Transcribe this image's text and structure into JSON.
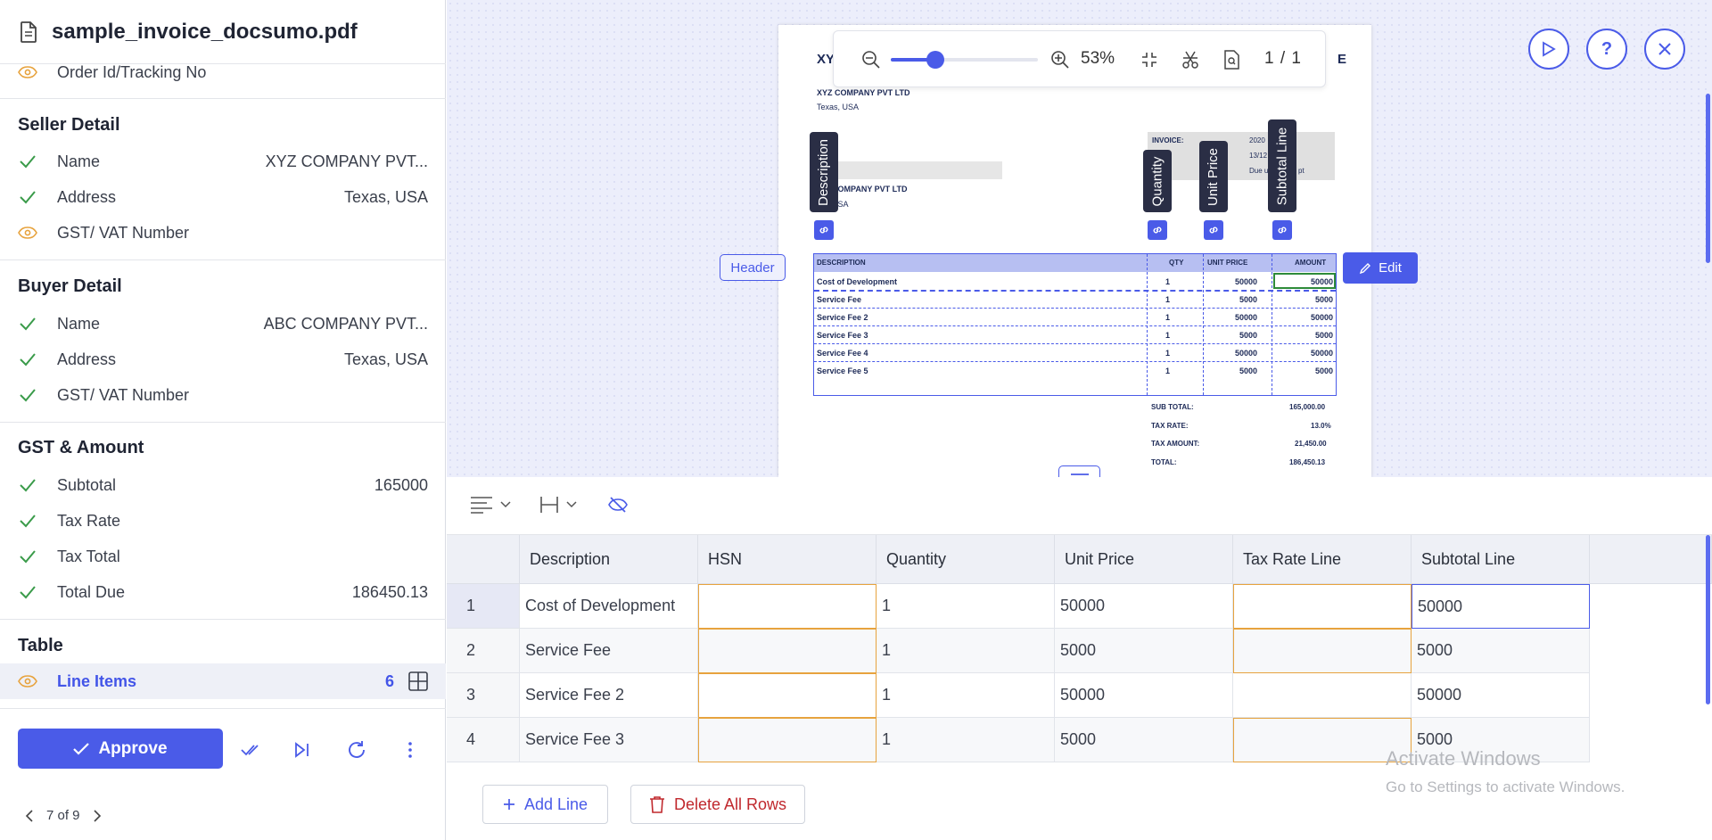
{
  "file": {
    "name": "sample_invoice_docsumo.pdf"
  },
  "fields": {
    "order_id": {
      "label": "Order Id/Tracking No"
    },
    "seller": {
      "title": "Seller Detail",
      "rows": [
        {
          "label": "Name",
          "value": "XYZ COMPANY PVT...",
          "status": "check"
        },
        {
          "label": "Address",
          "value": "Texas, USA",
          "status": "check"
        },
        {
          "label": "GST/ VAT Number",
          "value": "",
          "status": "eye"
        }
      ]
    },
    "buyer": {
      "title": "Buyer Detail",
      "rows": [
        {
          "label": "Name",
          "value": "ABC COMPANY PVT...",
          "status": "check"
        },
        {
          "label": "Address",
          "value": "Texas, USA",
          "status": "check"
        },
        {
          "label": "GST/ VAT Number",
          "value": "",
          "status": "check"
        }
      ]
    },
    "gst": {
      "title": "GST & Amount",
      "rows": [
        {
          "label": "Subtotal",
          "value": "165000",
          "status": "check"
        },
        {
          "label": "Tax Rate",
          "value": "",
          "status": "check"
        },
        {
          "label": "Tax Total",
          "value": "",
          "status": "check"
        },
        {
          "label": "Total Due",
          "value": "186450.13",
          "status": "check"
        }
      ]
    },
    "table": {
      "title": "Table",
      "line_items_label": "Line Items",
      "line_items_count": "6"
    }
  },
  "actions": {
    "approve": "Approve"
  },
  "pager": {
    "text": "7 of 9"
  },
  "viewer": {
    "zoom_text": "53%",
    "zoom_level": 0.3,
    "page_indicator": "1 / 1",
    "header_tag": "Header",
    "edit_label": "Edit",
    "column_tags": {
      "description": "Description",
      "quantity": "Quantity",
      "unit_price": "Unit Price",
      "subtotal": "Subtotal Line"
    }
  },
  "invoice": {
    "title_left": "XY",
    "title_right": "E",
    "seller_name": "XYZ COMPANY PVT LTD",
    "seller_addr": "Texas, USA",
    "bill_to_fragment": "D",
    "buyer_name_fragment": "COMPANY PVT LTD",
    "buyer_addr_fragment": "USA",
    "meta_labels": [
      "INVOICE:",
      "",
      "S:"
    ],
    "meta_values": [
      "2020",
      "13/12",
      "Due u"
    ],
    "meta_value_tail": "pt",
    "headers": [
      "DESCRIPTION",
      "QTY",
      "UNIT PRICE",
      "AMOUNT"
    ],
    "rows": [
      [
        "Cost of Development",
        "1",
        "50000",
        "50000"
      ],
      [
        "Service Fee",
        "1",
        "5000",
        "5000"
      ],
      [
        "Service Fee 2",
        "1",
        "50000",
        "50000"
      ],
      [
        "Service Fee 3",
        "1",
        "5000",
        "5000"
      ],
      [
        "Service Fee 4",
        "1",
        "50000",
        "50000"
      ],
      [
        "Service Fee 5",
        "1",
        "5000",
        "5000"
      ]
    ],
    "totals": [
      [
        "SUB TOTAL:",
        "165,000.00"
      ],
      [
        "TAX RATE:",
        "13.0%"
      ],
      [
        "TAX AMOUNT:",
        "21,450.00"
      ],
      [
        "TOTAL:",
        "186,450.13"
      ]
    ]
  },
  "grid": {
    "columns": [
      "Description",
      "HSN",
      "Quantity",
      "Unit Price",
      "Tax Rate Line",
      "Subtotal Line"
    ],
    "rows": [
      {
        "n": "1",
        "cells": [
          "Cost of Development",
          "",
          "1",
          "50000",
          "",
          "50000"
        ]
      },
      {
        "n": "2",
        "cells": [
          "Service Fee",
          "",
          "1",
          "5000",
          "",
          "5000"
        ]
      },
      {
        "n": "3",
        "cells": [
          "Service Fee 2",
          "",
          "1",
          "50000",
          "",
          "50000"
        ]
      },
      {
        "n": "4",
        "cells": [
          "Service Fee 3",
          "",
          "1",
          "5000",
          "",
          "5000"
        ]
      }
    ]
  },
  "bottom": {
    "add_line": "Add Line",
    "delete_all": "Delete All Rows"
  },
  "watermark": {
    "line1": "Activate Windows",
    "line2": "Go to Settings to activate Windows."
  },
  "colors": {
    "accent": "#4a5be8",
    "check": "#3a9b4a",
    "eye": "#e7a33e",
    "danger": "#c0282d"
  }
}
